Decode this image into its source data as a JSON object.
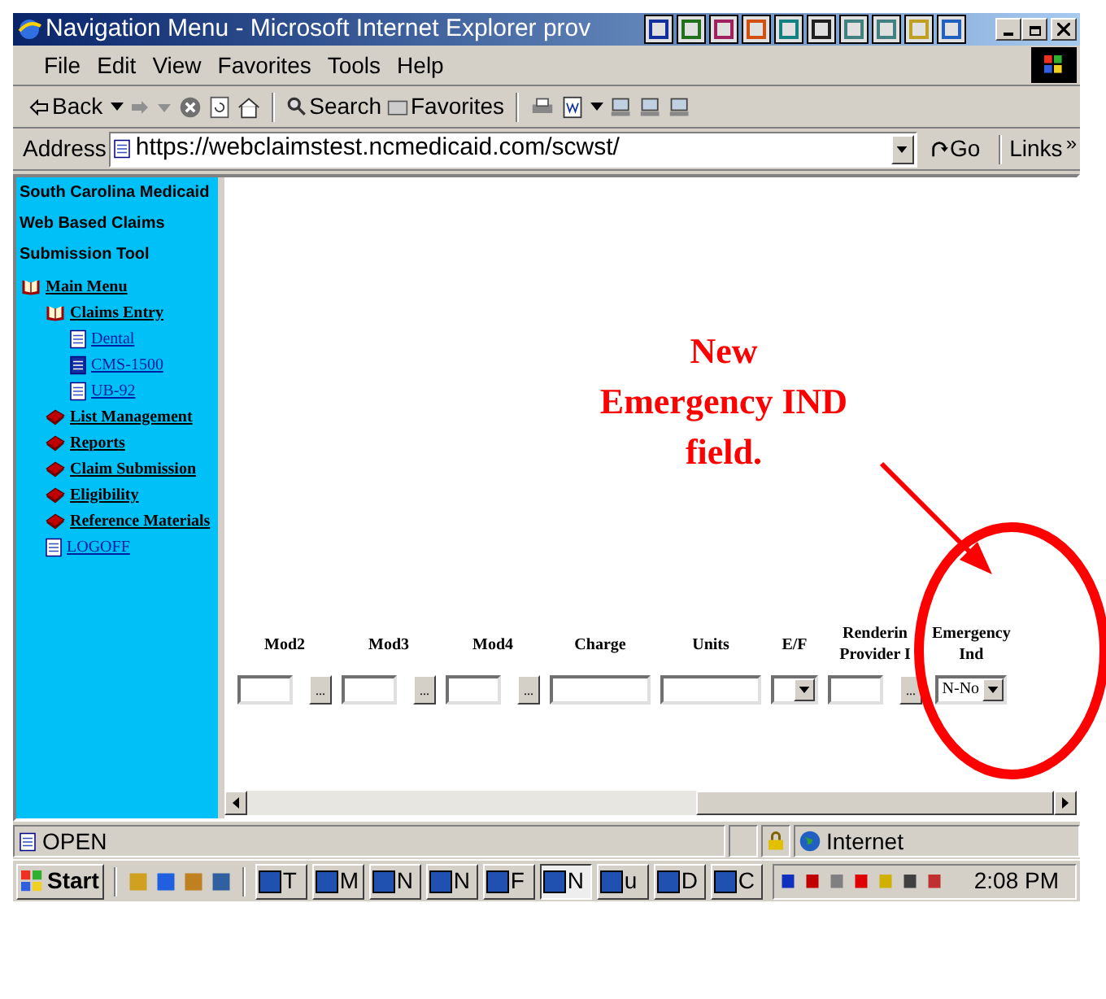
{
  "window": {
    "title": "Navigation Menu - Microsoft Internet Explorer prov"
  },
  "menu": [
    "File",
    "Edit",
    "View",
    "Favorites",
    "Tools",
    "Help"
  ],
  "toolbar": {
    "back": "Back",
    "search": "Search",
    "favorites": "Favorites"
  },
  "address": {
    "label": "Address",
    "url": "https://webclaimstest.ncmedicaid.com/scwst/",
    "go": "Go",
    "links": "Links",
    "more": "»"
  },
  "sidebar": {
    "heading": [
      "South Carolina Medicaid",
      "Web Based Claims",
      "Submission Tool"
    ],
    "items": [
      {
        "label": "Main Menu",
        "kind": "open-book",
        "children": [
          {
            "label": "Claims Entry",
            "kind": "open-book",
            "children": [
              {
                "label": "Dental",
                "kind": "page"
              },
              {
                "label": "CMS-1500",
                "kind": "page-current"
              },
              {
                "label": "UB-92",
                "kind": "page"
              }
            ]
          },
          {
            "label": "List Management",
            "kind": "book"
          },
          {
            "label": "Reports",
            "kind": "book"
          },
          {
            "label": "Claim Submission",
            "kind": "book"
          },
          {
            "label": "Eligibility",
            "kind": "book"
          },
          {
            "label": "Reference Materials",
            "kind": "book"
          },
          {
            "label": "LOGOFF",
            "kind": "page"
          }
        ]
      }
    ]
  },
  "form": {
    "columns": [
      {
        "label": [
          "Mod2"
        ],
        "kind": "text-lookup",
        "lookup": "..."
      },
      {
        "label": [
          "Mod3"
        ],
        "kind": "text-lookup",
        "lookup": "..."
      },
      {
        "label": [
          "Mod4"
        ],
        "kind": "text-lookup",
        "lookup": "..."
      },
      {
        "label": [
          "Charge"
        ],
        "kind": "text"
      },
      {
        "label": [
          "Units"
        ],
        "kind": "text"
      },
      {
        "label": [
          "E/F"
        ],
        "kind": "select"
      },
      {
        "label": [
          "Renderin",
          "Provider I"
        ],
        "kind": "text-lookup",
        "lookup": "..."
      },
      {
        "label": [
          "Emergency",
          "Ind"
        ],
        "kind": "select",
        "value": "N-No"
      }
    ]
  },
  "annotation": {
    "lines": [
      "New",
      "Emergency IND",
      "field."
    ]
  },
  "status_bar": {
    "text": "OPEN",
    "zone": "Internet"
  },
  "taskbar": {
    "start": "Start",
    "tasks": [
      "T",
      "M",
      "N",
      "N",
      "F",
      "N",
      "u",
      "D",
      "C"
    ],
    "clock": "2:08 PM"
  }
}
